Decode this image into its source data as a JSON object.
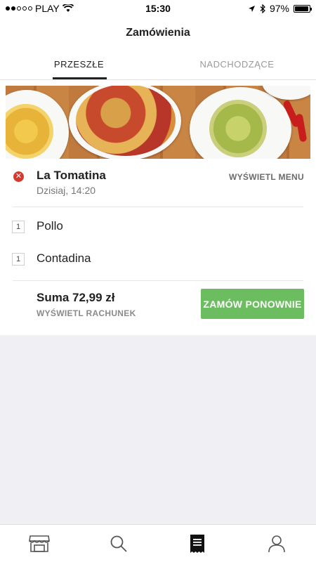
{
  "status_bar": {
    "carrier": "PLAY",
    "time": "15:30",
    "battery": "97%",
    "battery_level": 0.97
  },
  "header": {
    "title": "Zamówienia"
  },
  "tabs": [
    {
      "label": "PRZESZŁE",
      "active": true
    },
    {
      "label": "NADCHODZĄCE",
      "active": false
    }
  ],
  "order": {
    "restaurant": "La Tomatina",
    "status_icon": "cancel-icon",
    "datetime": "Dzisiaj, 14:20",
    "menu_link": "WYŚWIETL MENU",
    "items": [
      {
        "qty": "1",
        "name": "Pollo"
      },
      {
        "qty": "1",
        "name": "Contadina"
      }
    ],
    "total": "Suma 72,99 zł",
    "receipt_link": "WYŚWIETL RACHUNEK",
    "reorder_button": "ZAMÓW PONOWNIE"
  },
  "bottom_tabs": [
    {
      "icon": "storefront-icon"
    },
    {
      "icon": "search-icon"
    },
    {
      "icon": "receipt-icon",
      "active": true
    },
    {
      "icon": "user-icon"
    }
  ],
  "colors": {
    "accent_green": "#6cbd60",
    "error_red": "#d63a2f"
  }
}
